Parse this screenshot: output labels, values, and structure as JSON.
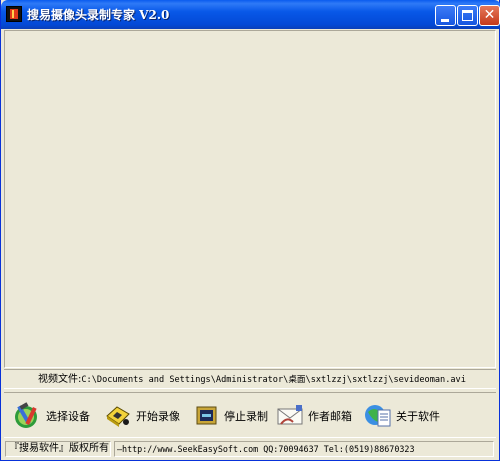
{
  "window": {
    "title": "搜易摄像头录制专家 V2.0",
    "icons": {
      "app": "camcorder-app-icon",
      "minimize": "minimize-icon",
      "maximize": "maximize-icon",
      "close": "close-icon"
    }
  },
  "file": {
    "label": "视频文件:",
    "path": "C:\\Documents and Settings\\Administrator\\桌面\\sxtlzzj\\sxtlzzj\\sevideoman.avi"
  },
  "toolbar": {
    "items": [
      {
        "label": "选择设备",
        "icon": "select-device-tools-icon"
      },
      {
        "label": "开始录像",
        "icon": "start-record-icon"
      },
      {
        "label": "停止录制",
        "icon": "stop-record-icon"
      },
      {
        "label": "作者邮箱",
        "icon": "author-email-icon"
      },
      {
        "label": "关于软件",
        "icon": "about-software-icon"
      }
    ]
  },
  "status": {
    "copyright": "『搜易软件』版权所有",
    "contact": "—http://www.SeekEasySoft.com QQ:70094637 Tel:(0519)88670323"
  },
  "colors": {
    "titlebar": "#0858E8",
    "face": "#ECE9D8",
    "close_button": "#C5391A"
  }
}
